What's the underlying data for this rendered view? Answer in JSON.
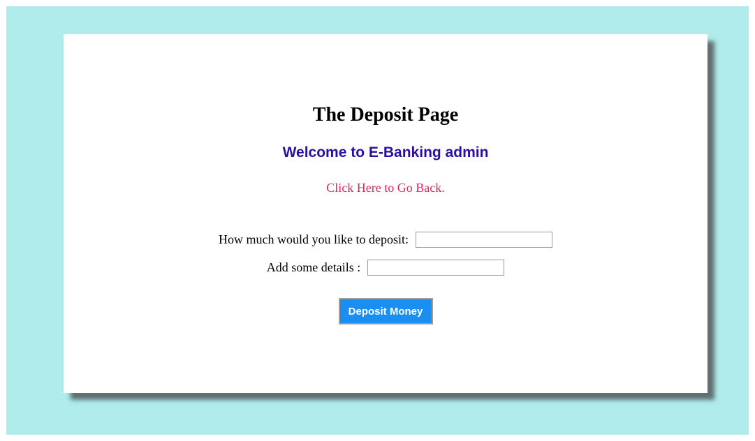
{
  "page": {
    "title": "The Deposit Page",
    "welcome": "Welcome to E-Banking admin",
    "back_link": "Click Here to Go Back."
  },
  "form": {
    "amount": {
      "label": "How much would you like to deposit:",
      "value": ""
    },
    "details": {
      "label": "Add some details :",
      "value": ""
    },
    "submit_label": "Deposit Money"
  },
  "colors": {
    "background": "#b0ecec",
    "card": "#ffffff",
    "welcome_text": "#2b0ea0",
    "link": "#e0245e",
    "button": "#1b8ef2"
  }
}
